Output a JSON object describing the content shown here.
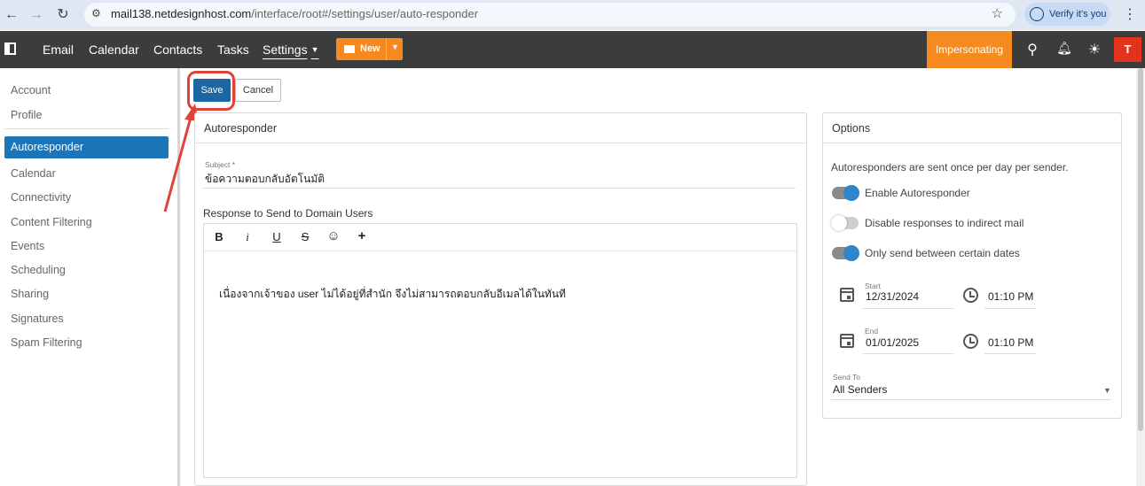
{
  "browser": {
    "url_host": "mail138.netdesignhost.com",
    "url_path": "/interface/root#/settings/user/auto-responder",
    "verify_label": "Verify it's you"
  },
  "appbar": {
    "nav": [
      "Email",
      "Calendar",
      "Contacts",
      "Tasks",
      "Settings"
    ],
    "new_label": "New",
    "impersonating_label": "Impersonating",
    "avatar_letter": "T",
    "accent": "#f58a1f",
    "avatar_color": "#e2331f"
  },
  "sidebar": {
    "top_items": [
      "Account",
      "Profile"
    ],
    "active_item": "Autoresponder",
    "items": [
      "Calendar",
      "Connectivity",
      "Content Filtering",
      "Events",
      "Scheduling",
      "Sharing",
      "Signatures",
      "Spam Filtering"
    ],
    "active_color": "#1b75b7"
  },
  "toolbar": {
    "save_label": "Save",
    "cancel_label": "Cancel"
  },
  "autoresponder": {
    "title": "Autoresponder",
    "subject_label": "Subject *",
    "subject_value": "ข้อความตอบกลับอัตโนมัติ",
    "response_label": "Response to Send to Domain Users",
    "editor_tools": [
      "B",
      "i",
      "U",
      "S",
      "☺",
      "+"
    ],
    "body_text": "เนื่องจากเจ้าของ user ไม่ได้อยู่ที่สำนัก จึงไม่สามารถตอบกลับอีเมลได้ในทันที"
  },
  "options": {
    "title": "Options",
    "info": "Autoresponders are sent once per day per sender.",
    "toggles": [
      {
        "label": "Enable Autoresponder",
        "on": true
      },
      {
        "label": "Disable responses to indirect mail",
        "on": false
      },
      {
        "label": "Only send between certain dates",
        "on": true
      }
    ],
    "start_label": "Start",
    "start_date": "12/31/2024",
    "start_time": "01:10 PM",
    "end_label": "End",
    "end_date": "01/01/2025",
    "end_time": "01:10 PM",
    "send_to_label": "Send To",
    "send_to_value": "All Senders"
  }
}
